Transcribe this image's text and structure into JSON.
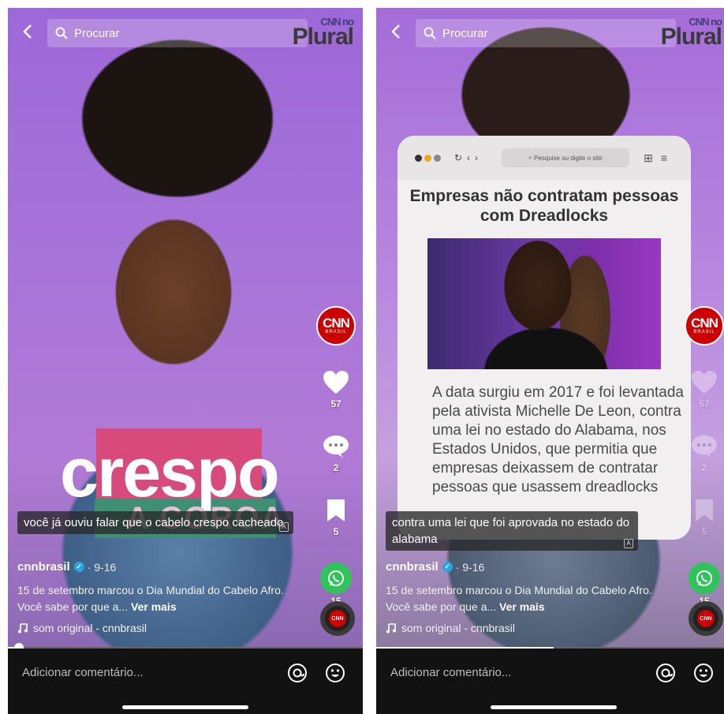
{
  "left": {
    "search_label": "Procurar",
    "brand": {
      "top": "CNN no",
      "word": "Plural"
    },
    "overlay": {
      "main": "crespo",
      "sub": "A COROA"
    },
    "caption": "você já ouviu falar que o cabelo crespo cacheado",
    "rail": {
      "badge_cnn": "CNN",
      "badge_brasil": "BRASIL",
      "likes": "57",
      "comments": "2",
      "saves": "5",
      "shares": "15"
    },
    "meta": {
      "username": "cnnbrasil",
      "date": "· 9-16",
      "description": "15 de setembro marcou o Dia Mundial do Cabelo Afro. Você sabe por que a...",
      "see_more": "Ver mais",
      "sound": "som original - cnnbrasil"
    },
    "progress_fraction": 0.03,
    "comment_placeholder": "Adicionar comentário..."
  },
  "right": {
    "search_label": "Procurar",
    "brand": {
      "top": "CNN no",
      "word": "Plural"
    },
    "browser": {
      "url_placeholder": "Pesquise ou digite o site",
      "headline": "Empresas não contratam pessoas com Dreadlocks",
      "article": "A data surgiu em 2017 e foi levantada pela ativista Michelle De Leon, contra uma lei no estado do Alabama, nos Estados Unidos, que permitia que empresas deixassem de contratar pessoas que usassem dreadlocks"
    },
    "caption": "contra uma lei que foi aprovada no estado do alabama",
    "rail": {
      "badge_cnn": "CNN",
      "badge_brasil": "BRASIL",
      "likes": "57",
      "comments": "2",
      "saves": "5",
      "shares": "15"
    },
    "meta": {
      "username": "cnnbrasil",
      "date": "· 9-16",
      "description": "15 de setembro marcou o Dia Mundial do Cabelo Afro. Você sabe por que a...",
      "see_more": "Ver mais",
      "sound": "som original - cnnbrasil"
    },
    "progress_fraction": 0.5,
    "comment_placeholder": "Adicionar comentário..."
  },
  "colors": {
    "cnn_red": "#cc0000",
    "whatsapp_green": "#2fc45a",
    "verified_blue": "#27a6e5"
  }
}
